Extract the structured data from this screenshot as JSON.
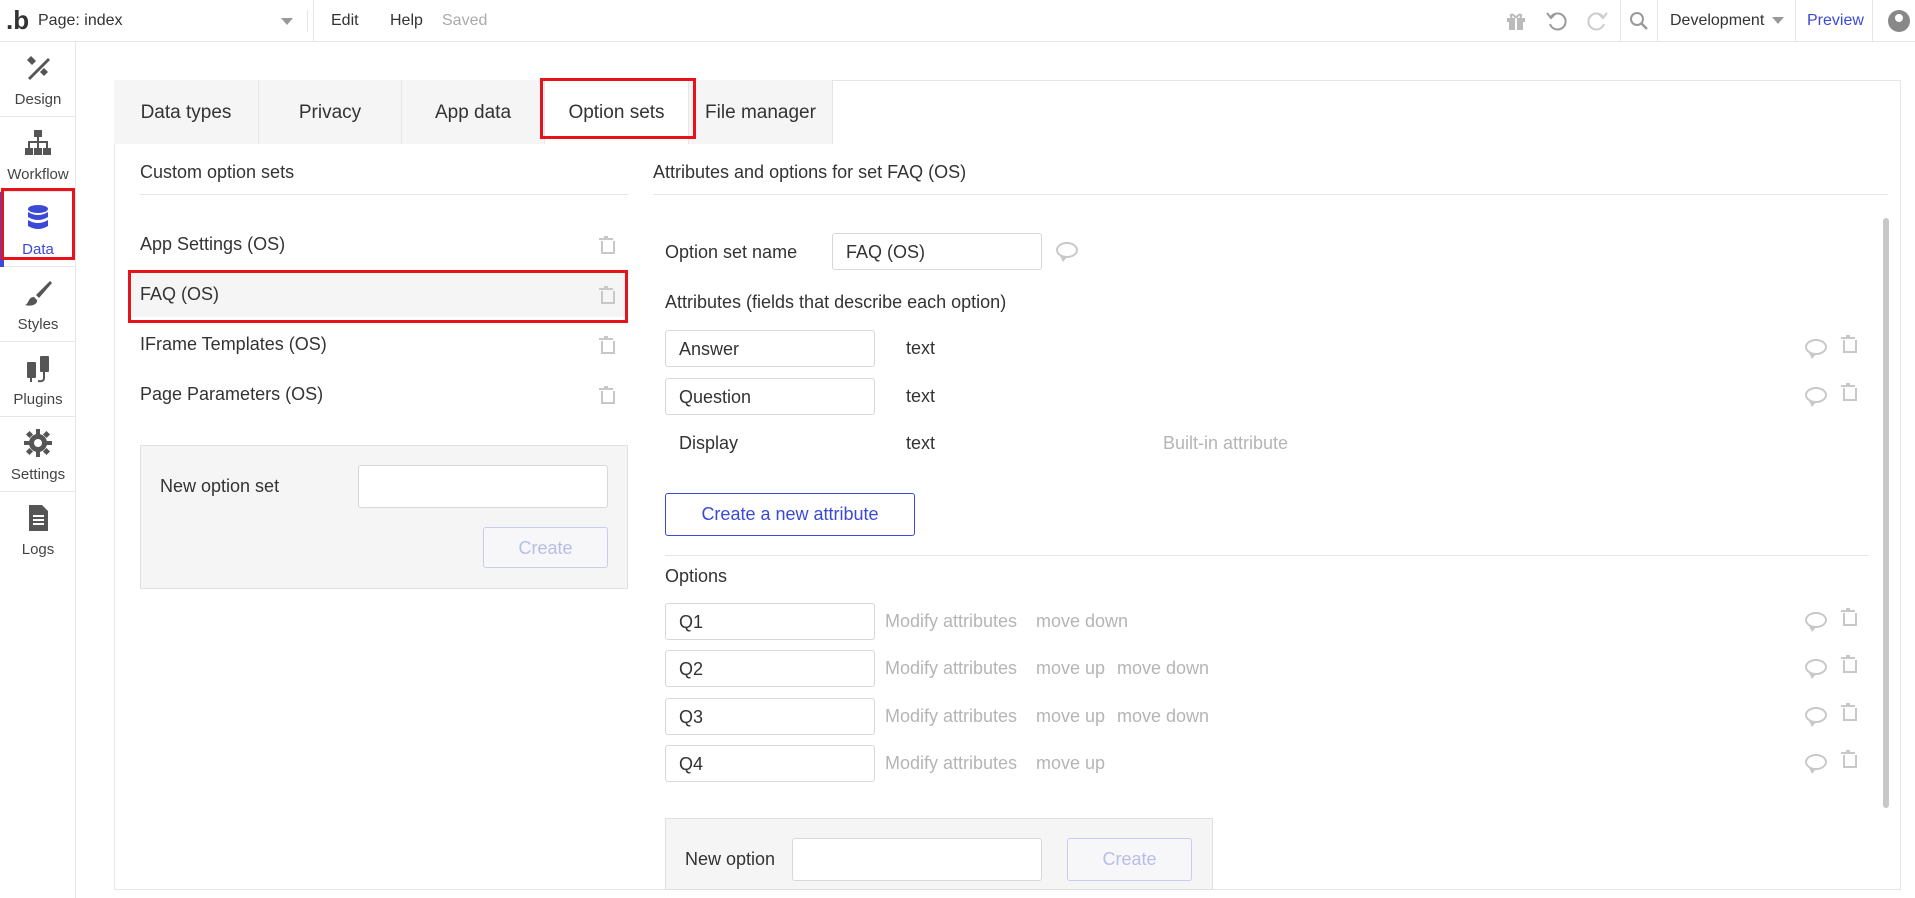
{
  "topbar": {
    "logo": ".b",
    "page_selector": "Page: index",
    "menu": [
      "Edit",
      "Help"
    ],
    "status": "Saved",
    "icons": [
      "gift-icon",
      "undo-icon",
      "redo-icon",
      "search-icon"
    ],
    "environment": "Development",
    "preview": "Preview"
  },
  "sidebar": {
    "items": [
      {
        "label": "Design",
        "icon": "design-icon"
      },
      {
        "label": "Workflow",
        "icon": "workflow-icon"
      },
      {
        "label": "Data",
        "icon": "database-icon",
        "active": true
      },
      {
        "label": "Styles",
        "icon": "brush-icon"
      },
      {
        "label": "Plugins",
        "icon": "plug-icon"
      },
      {
        "label": "Settings",
        "icon": "gear-icon"
      },
      {
        "label": "Logs",
        "icon": "document-icon"
      }
    ]
  },
  "tabs": [
    "Data types",
    "Privacy",
    "App data",
    "Option sets",
    "File manager"
  ],
  "active_tab": "Option sets",
  "left": {
    "title": "Custom option sets",
    "option_sets": [
      "App Settings (OS)",
      "FAQ (OS)",
      "IFrame Templates (OS)",
      "Page Parameters (OS)"
    ],
    "selected": "FAQ (OS)",
    "new_label": "New option set",
    "new_value": "",
    "create": "Create"
  },
  "right": {
    "title": "Attributes and options for set FAQ (OS)",
    "name_label": "Option set name",
    "name_value": "FAQ (OS)",
    "attributes_label": "Attributes (fields that describe each option)",
    "attributes": [
      {
        "name": "Answer",
        "type": "text",
        "note": ""
      },
      {
        "name": "Question",
        "type": "text",
        "note": ""
      },
      {
        "name": "Display",
        "type": "text",
        "note": "Built-in attribute"
      }
    ],
    "create_attribute": "Create a new attribute",
    "options_label": "Options",
    "options": [
      {
        "name": "Q1",
        "actions": [
          "Modify attributes",
          "move down"
        ]
      },
      {
        "name": "Q2",
        "actions": [
          "Modify attributes",
          "move up",
          "move down"
        ]
      },
      {
        "name": "Q3",
        "actions": [
          "Modify attributes",
          "move up",
          "move down"
        ]
      },
      {
        "name": "Q4",
        "actions": [
          "Modify attributes",
          "move up"
        ]
      }
    ],
    "new_option_label": "New option",
    "new_option_value": "",
    "create": "Create"
  },
  "colors": {
    "accent": "#3b49d6",
    "highlight": "#e8121d",
    "muted_text": "#b5b5b5",
    "panel_bg": "#f5f5f5"
  }
}
